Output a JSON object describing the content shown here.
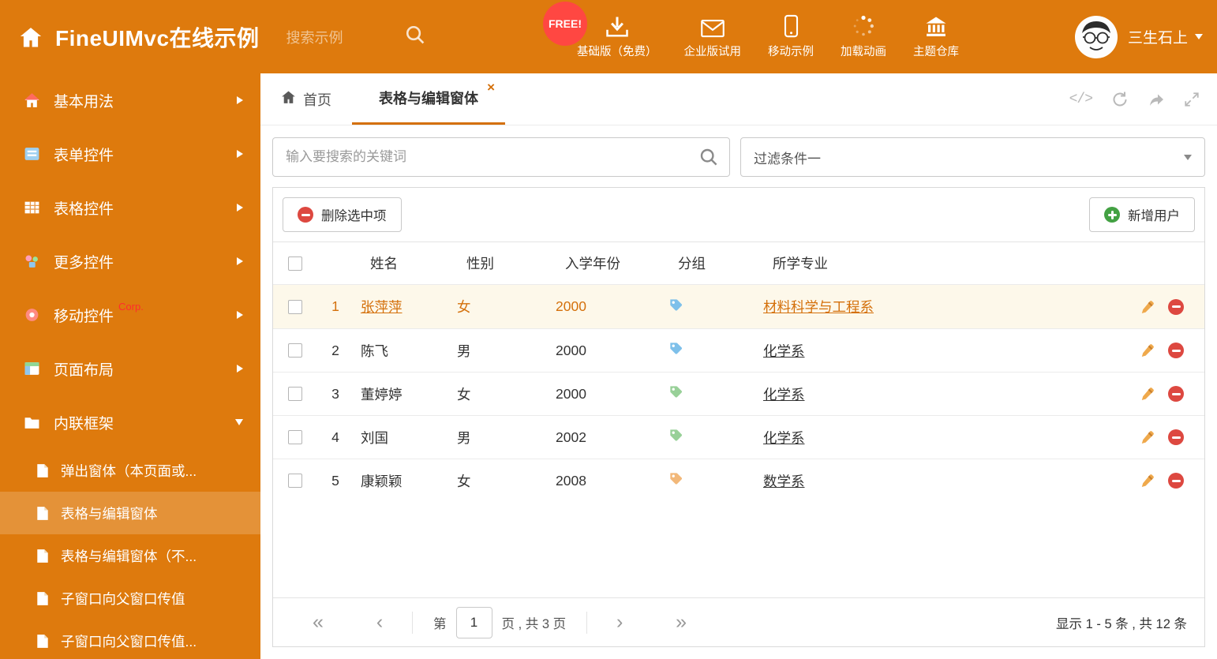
{
  "colors": {
    "brand_orange": "#de7a0d",
    "accent_orange": "#d4700b",
    "selected_row_bg": "#fdf8ea",
    "free_badge_red": "#ff4742",
    "corp_red": "#ff2d2d",
    "delete_red": "#dd4840",
    "add_green": "#43a143",
    "tag_blue": "#7ec0ea",
    "tag_green": "#98d098",
    "tag_orange": "#f2b879"
  },
  "header": {
    "title": "FineUIMvc在线示例",
    "search_placeholder": "搜索示例",
    "free_badge": "FREE!",
    "nav": [
      {
        "label": "基础版（免费）",
        "icon": "download-icon"
      },
      {
        "label": "企业版试用",
        "icon": "mail-icon"
      },
      {
        "label": "移动示例",
        "icon": "mobile-icon"
      },
      {
        "label": "加载动画",
        "icon": "spinner-icon"
      },
      {
        "label": "主题仓库",
        "icon": "bank-icon"
      }
    ],
    "user": {
      "name": "三生石上"
    }
  },
  "sidebar": {
    "items": [
      {
        "label": "基本用法"
      },
      {
        "label": "表单控件"
      },
      {
        "label": "表格控件"
      },
      {
        "label": "更多控件"
      },
      {
        "label": "移动控件",
        "badge": "Corp."
      },
      {
        "label": "页面布局"
      },
      {
        "label": "内联框架",
        "expanded": true
      }
    ],
    "subitems": [
      {
        "label": "弹出窗体（本页面或..."
      },
      {
        "label": "表格与编辑窗体",
        "selected": true
      },
      {
        "label": "表格与编辑窗体（不..."
      },
      {
        "label": "子窗口向父窗口传值"
      },
      {
        "label": "子窗口向父窗口传值..."
      }
    ]
  },
  "tabs": {
    "home_label": "首页",
    "active_label": "表格与编辑窗体",
    "close_glyph": "×",
    "code_glyph": "</>"
  },
  "filters": {
    "search_placeholder": "输入要搜索的关键词",
    "filter_value": "过滤条件一"
  },
  "toolbar": {
    "delete_label": "删除选中项",
    "add_label": "新增用户"
  },
  "table": {
    "headers": [
      "姓名",
      "性别",
      "入学年份",
      "分组",
      "所学专业"
    ],
    "rows": [
      {
        "num": "1",
        "name": "张萍萍",
        "gender": "女",
        "year": "2000",
        "tag_color": "#7ec0ea",
        "major": "材料科学与工程系",
        "selected": true
      },
      {
        "num": "2",
        "name": "陈飞",
        "gender": "男",
        "year": "2000",
        "tag_color": "#7ec0ea",
        "major": "化学系"
      },
      {
        "num": "3",
        "name": "董婷婷",
        "gender": "女",
        "year": "2000",
        "tag_color": "#98d098",
        "major": "化学系"
      },
      {
        "num": "4",
        "name": "刘国",
        "gender": "男",
        "year": "2002",
        "tag_color": "#98d098",
        "major": "化学系"
      },
      {
        "num": "5",
        "name": "康颖颖",
        "gender": "女",
        "year": "2008",
        "tag_color": "#f2b879",
        "major": "数学系"
      }
    ]
  },
  "pagination": {
    "icons": {
      "first": "«",
      "prev": "‹",
      "next": "›",
      "last": "»"
    },
    "page_prefix": "第",
    "current_page": "1",
    "page_suffix": "页 , 共 3 页",
    "summary": "显示 1 - 5 条 , 共 12 条"
  }
}
